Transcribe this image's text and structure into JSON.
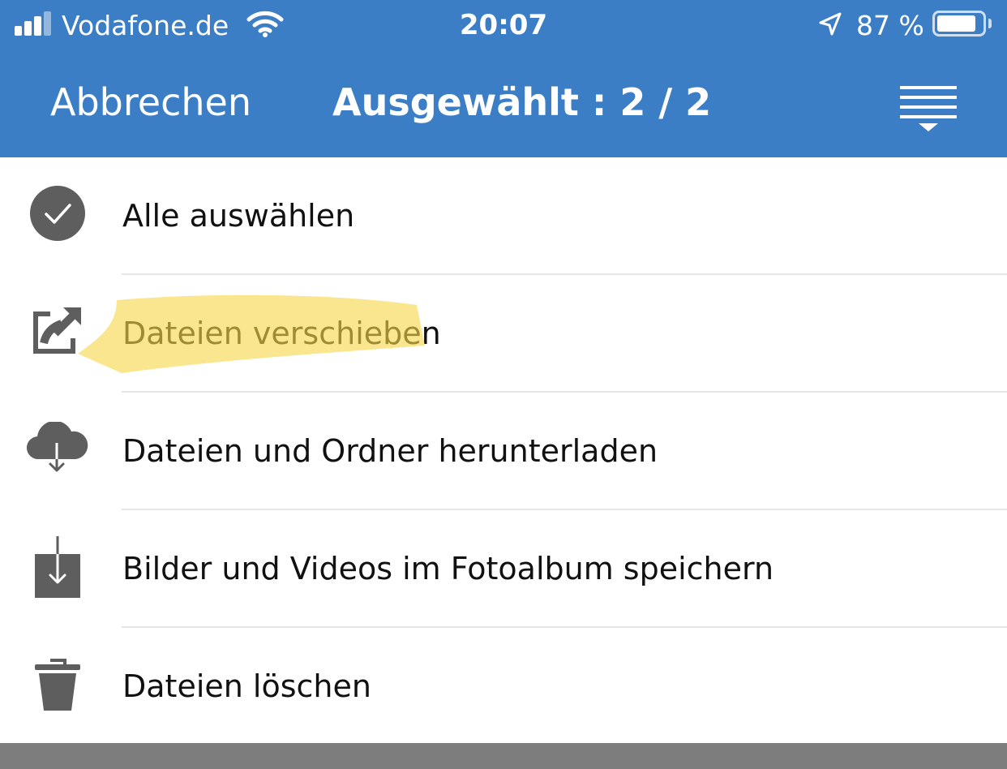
{
  "status_bar": {
    "carrier": "Vodafone.de",
    "time": "20:07",
    "battery_percent": "87 %",
    "battery_level": 0.87,
    "signal_bars": 3,
    "icons": [
      "signal-icon",
      "wifi-icon",
      "location-arrow-icon",
      "battery-icon"
    ]
  },
  "nav_bar": {
    "cancel_label": "Abbrechen",
    "title": "Ausgewählt : 2 / 2",
    "menu_icon": "filter-sort-icon"
  },
  "menu": {
    "items": [
      {
        "label": "Alle auswählen",
        "icon": "check-circle-icon"
      },
      {
        "label": "Dateien verschieben",
        "icon": "move-export-icon",
        "highlighted": true
      },
      {
        "label": "Dateien und Ordner herunterladen",
        "icon": "cloud-download-icon"
      },
      {
        "label": "Bilder und Videos im Fotoalbum speichern",
        "icon": "save-to-album-icon"
      },
      {
        "label": "Dateien löschen",
        "icon": "trash-icon"
      }
    ]
  },
  "colors": {
    "accent": "#3b7ec6",
    "icon_gray": "#5e5e5e",
    "highlight": "#f6d64a",
    "backdrop": "#7d7d7d"
  }
}
